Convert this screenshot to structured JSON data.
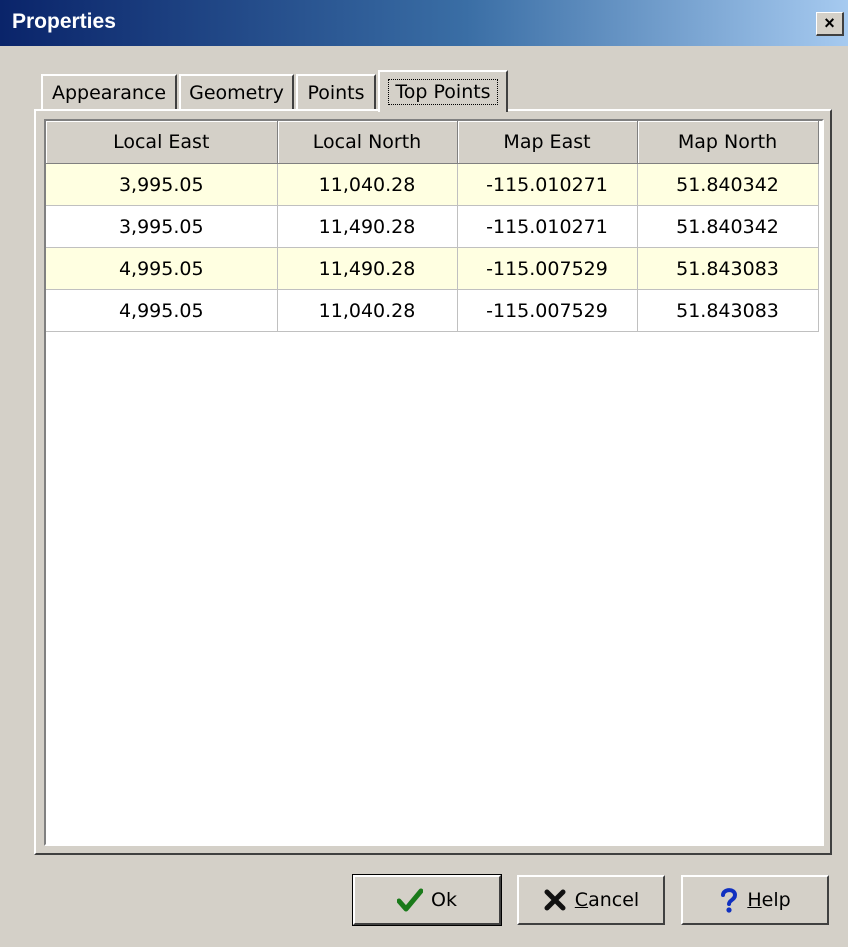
{
  "window": {
    "title": "Properties",
    "close_symbol": "×"
  },
  "tabs": [
    {
      "label": "Appearance",
      "active": false
    },
    {
      "label": "Geometry",
      "active": false
    },
    {
      "label": "Points",
      "active": false
    },
    {
      "label": "Top Points",
      "active": true
    }
  ],
  "table": {
    "columns": [
      "Local East",
      "Local North",
      "Map East",
      "Map North"
    ],
    "rows": [
      [
        "3,995.05",
        "11,040.28",
        "-115.010271",
        "51.840342"
      ],
      [
        "3,995.05",
        "11,490.28",
        "-115.010271",
        "51.840342"
      ],
      [
        "4,995.05",
        "11,490.28",
        "-115.007529",
        "51.843083"
      ],
      [
        "4,995.05",
        "11,040.28",
        "-115.007529",
        "51.843083"
      ]
    ]
  },
  "buttons": {
    "ok": {
      "label": "Ok",
      "icon": "checkmark-icon",
      "icon_color": "#1a7a1a"
    },
    "cancel": {
      "label_first": "C",
      "label_rest": "ancel",
      "icon": "x-mark-icon",
      "icon_color": "#111111"
    },
    "help": {
      "label_first": "H",
      "label_rest": "elp",
      "icon": "question-mark-icon",
      "icon_color": "#1030c0"
    }
  },
  "colors": {
    "titlebar_start": "#0a246a",
    "titlebar_end": "#a6caf0",
    "row_alt": "#ffffe1",
    "face": "#d4d0c8"
  }
}
